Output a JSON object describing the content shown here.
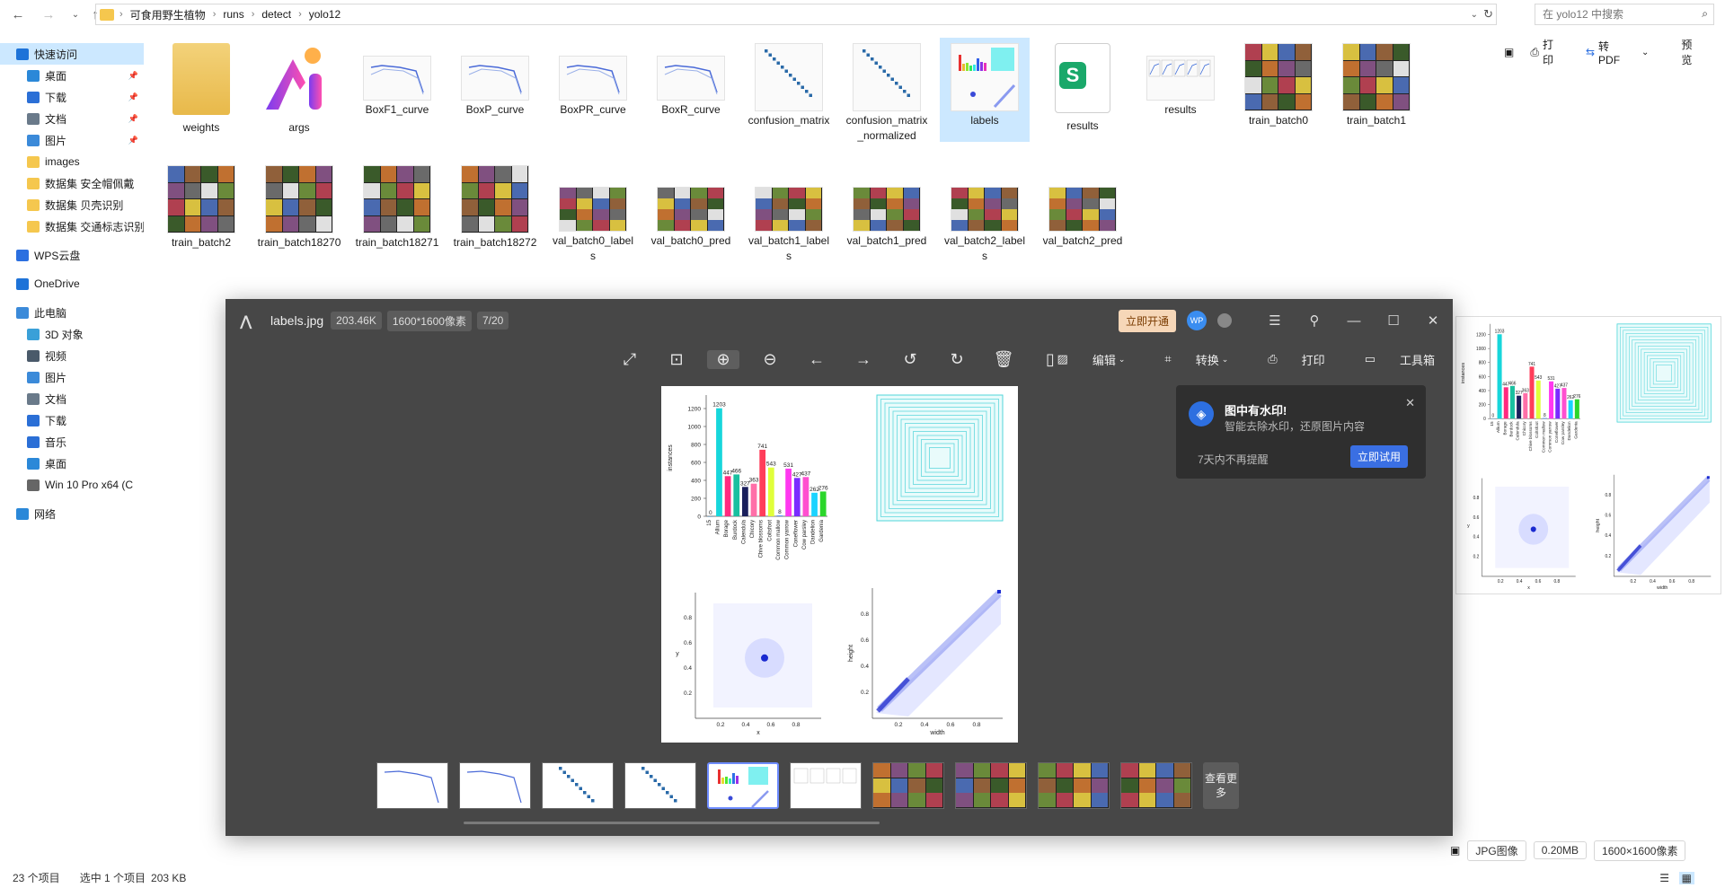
{
  "explorer": {
    "breadcrumbs": [
      "可食用野生植物",
      "runs",
      "detect",
      "yolo12"
    ],
    "search_placeholder": "在 yolo12 中搜索"
  },
  "sidebar": {
    "items": [
      {
        "label": "快速访问",
        "icon": "star-icon",
        "color": "#1e73d8",
        "pinned": false
      },
      {
        "label": "桌面",
        "icon": "desktop-icon",
        "color": "#2b88d8",
        "pinned": true
      },
      {
        "label": "下载",
        "icon": "download-icon",
        "color": "#2b6fd6",
        "pinned": true
      },
      {
        "label": "文档",
        "icon": "document-icon",
        "color": "#6a7a8a",
        "pinned": true
      },
      {
        "label": "图片",
        "icon": "picture-icon",
        "color": "#3b8ad9",
        "pinned": true
      },
      {
        "label": "images",
        "icon": "folder-icon",
        "color": "#f5c74e",
        "pinned": false
      },
      {
        "label": "数据集 安全帽佩戴",
        "icon": "folder-icon",
        "color": "#f5c74e",
        "pinned": false
      },
      {
        "label": "数据集 贝壳识别",
        "icon": "folder-icon",
        "color": "#f5c74e",
        "pinned": false
      },
      {
        "label": "数据集 交通标志识别",
        "icon": "folder-icon",
        "color": "#f5c74e",
        "pinned": false
      },
      {
        "label": "WPS云盘",
        "icon": "cloud-icon",
        "color": "#2b6fe0",
        "pinned": false
      },
      {
        "label": "OneDrive",
        "icon": "onedrive-icon",
        "color": "#1e73d8",
        "pinned": false
      },
      {
        "label": "此电脑",
        "icon": "computer-icon",
        "color": "#3b8ad9",
        "pinned": false
      },
      {
        "label": "3D 对象",
        "icon": "cube-icon",
        "color": "#3aa0d8",
        "pinned": false
      },
      {
        "label": "视频",
        "icon": "video-icon",
        "color": "#4a5a6a",
        "pinned": false
      },
      {
        "label": "图片",
        "icon": "picture-icon",
        "color": "#3b8ad9",
        "pinned": false
      },
      {
        "label": "文档",
        "icon": "document-icon",
        "color": "#6a7a8a",
        "pinned": false
      },
      {
        "label": "下载",
        "icon": "download-icon",
        "color": "#2b6fd6",
        "pinned": false
      },
      {
        "label": "音乐",
        "icon": "music-icon",
        "color": "#2b6fd6",
        "pinned": false
      },
      {
        "label": "桌面",
        "icon": "desktop-icon",
        "color": "#2b88d8",
        "pinned": false
      },
      {
        "label": "Win 10 Pro x64 (C",
        "icon": "drive-icon",
        "color": "#666666",
        "pinned": false
      },
      {
        "label": "网络",
        "icon": "network-icon",
        "color": "#2b88d8",
        "pinned": false
      }
    ]
  },
  "files": [
    {
      "name": "weights",
      "kind": "folder"
    },
    {
      "name": "args",
      "kind": "app"
    },
    {
      "name": "BoxF1_curve",
      "kind": "curve"
    },
    {
      "name": "BoxP_curve",
      "kind": "curve"
    },
    {
      "name": "BoxPR_curve",
      "kind": "curve"
    },
    {
      "name": "BoxR_curve",
      "kind": "curve"
    },
    {
      "name": "confusion_matrix",
      "kind": "matrix"
    },
    {
      "name": "confusion_matrix_normalized",
      "kind": "matrix"
    },
    {
      "name": "labels",
      "kind": "labels"
    },
    {
      "name": "results",
      "kind": "sheet"
    },
    {
      "name": "results",
      "kind": "results"
    },
    {
      "name": "train_batch0",
      "kind": "photo"
    },
    {
      "name": "train_batch1",
      "kind": "photo"
    },
    {
      "name": "train_batch2",
      "kind": "photo"
    },
    {
      "name": "train_batch18270",
      "kind": "photo"
    },
    {
      "name": "train_batch18271",
      "kind": "photo"
    },
    {
      "name": "train_batch18272",
      "kind": "photo"
    },
    {
      "name": "val_batch0_labels",
      "kind": "photo"
    },
    {
      "name": "val_batch0_pred",
      "kind": "photo"
    },
    {
      "name": "val_batch1_labels",
      "kind": "photo"
    },
    {
      "name": "val_batch1_pred",
      "kind": "photo"
    },
    {
      "name": "val_batch2_labels",
      "kind": "photo"
    },
    {
      "name": "val_batch2_pred",
      "kind": "photo"
    }
  ],
  "status": {
    "item_count": "23 个项目",
    "selection": "选中 1 个项目",
    "size": "203 KB"
  },
  "preview_pane": {
    "print": "打印",
    "to_pdf": "转PDF",
    "preview": "预览",
    "file_type": "JPG图像",
    "file_size": "0.20MB",
    "dimensions": "1600×1600像素"
  },
  "viewer": {
    "filename": "labels.jpg",
    "filesize": "203.46K",
    "resolution": "1600*1600像素",
    "index": "7/20",
    "open_vip": "立即开通",
    "avatar": "WP",
    "edit": "编辑",
    "convert": "转换",
    "print": "打印",
    "toolbox": "工具箱",
    "more": "查看更多"
  },
  "notice": {
    "title": "图中有水印!",
    "desc": "智能去除水印，还原图片内容",
    "skip": "7天内不再提醒",
    "button": "立即试用"
  },
  "chart_data": {
    "type": "bar",
    "ylabel": "instances",
    "categories": [
      "15",
      "Allium",
      "Borage",
      "Burdock",
      "Calendula",
      "Chicory",
      "Chive blossoms",
      "Coltsfoot",
      "Common mallow",
      "Common yarrow",
      "Coneflower",
      "Cow parsley",
      "Dandelion",
      "Gardenia"
    ],
    "values": [
      0,
      1203,
      447,
      466,
      327,
      363,
      741,
      543,
      8,
      531,
      427,
      437,
      262,
      276
    ],
    "data_labels": [
      "0",
      "1203",
      "447",
      "466",
      "327",
      "363",
      "741",
      "543",
      "8",
      "531",
      "427",
      "437",
      "262",
      "276"
    ],
    "ylim": [
      0,
      1300
    ],
    "yticks": [
      0,
      200,
      400,
      600,
      800,
      1000,
      1200
    ],
    "colors": [
      "#1f77b4",
      "#17d6db",
      "#ff2a7f",
      "#19c0a0",
      "#1a1f5c",
      "#ff6fa8",
      "#ff3d5a",
      "#e0ff3a",
      "#3a7bff",
      "#ff38f0",
      "#7a2cff",
      "#ff4fd0",
      "#1ad3ff",
      "#2bd62b"
    ],
    "scatter_xy": {
      "xlabel": "x",
      "ylabel": "y",
      "xticks": [
        "0.2",
        "0.4",
        "0.6",
        "0.8"
      ],
      "yticks": [
        "0.2",
        "0.4",
        "0.6",
        "0.8"
      ]
    },
    "scatter_wh": {
      "xlabel": "width",
      "ylabel": "height",
      "xticks": [
        "0.2",
        "0.4",
        "0.6",
        "0.8"
      ],
      "yticks": [
        "0.2",
        "0.4",
        "0.6",
        "0.8"
      ]
    }
  }
}
